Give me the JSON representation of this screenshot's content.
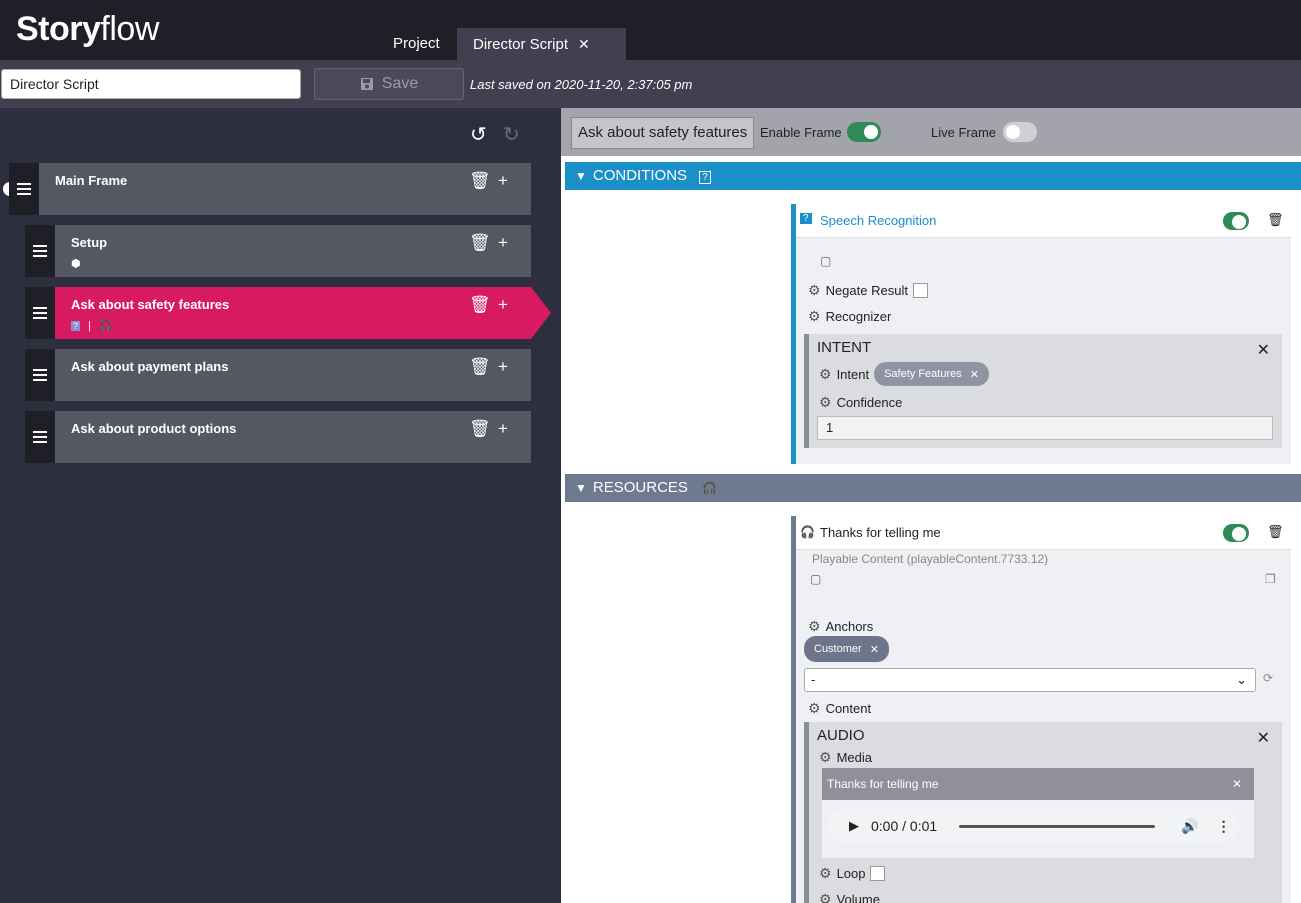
{
  "header": {
    "logo_bold": "Story",
    "logo_light": "flow",
    "tabs": [
      {
        "label": "Project"
      },
      {
        "label": "Director Script",
        "close": "✕"
      }
    ]
  },
  "toolbar": {
    "name_value": "Director Script",
    "save_label": "Save",
    "last_saved": "Last saved on 2020-11-20, 2:37:05 pm"
  },
  "frames": [
    {
      "title": "Main Frame"
    },
    {
      "title": "Setup"
    },
    {
      "title": "Ask about safety features"
    },
    {
      "title": "Ask about payment plans"
    },
    {
      "title": "Ask about product options"
    }
  ],
  "frame_editor": {
    "name": "Ask about safety features",
    "enable_frame_label": "Enable Frame",
    "enable_frame_on": true,
    "live_frame_label": "Live Frame",
    "live_frame_on": false
  },
  "conditions": {
    "heading": "CONDITIONS",
    "card_title": "Speech Recognition",
    "negate_label": "Negate Result",
    "recognizer_label": "Recognizer",
    "intent_box_title": "INTENT",
    "intent_label": "Intent",
    "intent_chip": "Safety Features",
    "confidence_label": "Confidence",
    "confidence_value": "1"
  },
  "resources": {
    "heading": "RESOURCES",
    "card_title": "Thanks for telling me",
    "playable_id": "Playable Content (playableContent.7733.12)",
    "anchors_label": "Anchors",
    "anchor_chip": "Customer",
    "anchor_select": "-",
    "content_label": "Content",
    "audio_box_title": "AUDIO",
    "media_label": "Media",
    "media_title": "Thanks for telling me",
    "player_time": "0:00 / 0:01",
    "loop_label": "Loop",
    "volume_label": "Volume"
  },
  "colors": {
    "accent": "#d81b60",
    "conditions": "#1a8fc8",
    "resources": "#6e7a90",
    "toggle_on": "#2e8b57"
  }
}
